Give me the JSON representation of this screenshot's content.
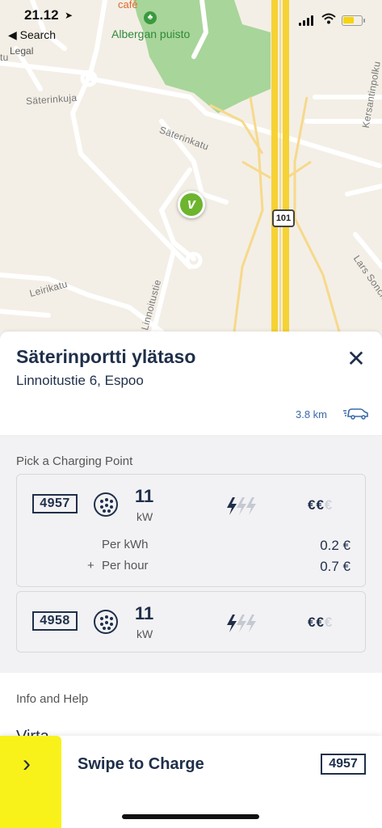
{
  "status_bar": {
    "time": "21.12",
    "back_label": "◀ Search"
  },
  "map": {
    "cafe": "café",
    "park": "Albergan puisto",
    "legal": "Legal",
    "streets": [
      {
        "name": "Säterinkuja"
      },
      {
        "name": "Säterinkatu"
      },
      {
        "name": "Leirikatu"
      },
      {
        "name": "Linnoitustie"
      },
      {
        "name": "Kersantinpolku"
      },
      {
        "name": "Lars Sonckin"
      },
      {
        "name": "tu"
      }
    ],
    "highway_shield": "101"
  },
  "station": {
    "title": "Säterinportti ylätaso",
    "address": "Linnoitustie 6, Espoo",
    "distance": "3.8 km"
  },
  "pick_label": "Pick a Charging Point",
  "charging_points": [
    {
      "id": "4957",
      "power": "11",
      "unit": "kW",
      "price_level": 2,
      "prices": [
        {
          "label": "Per kWh",
          "prefix": "",
          "value": "0.2 €"
        },
        {
          "label": "Per hour",
          "prefix": "+",
          "value": "0.7 €"
        }
      ]
    },
    {
      "id": "4958",
      "power": "11",
      "unit": "kW",
      "price_level": 2
    }
  ],
  "euro_symbols": {
    "on": "€€",
    "off": "€"
  },
  "info": {
    "label": "Info and Help",
    "item": "Virta"
  },
  "swipe": {
    "label": "Swipe to Charge",
    "id": "4957"
  },
  "colors": {
    "accent_yellow": "#f8f21a",
    "navy": "#1f2f4a",
    "pin_green": "#6cb52d",
    "link_blue": "#3b6aa8"
  }
}
